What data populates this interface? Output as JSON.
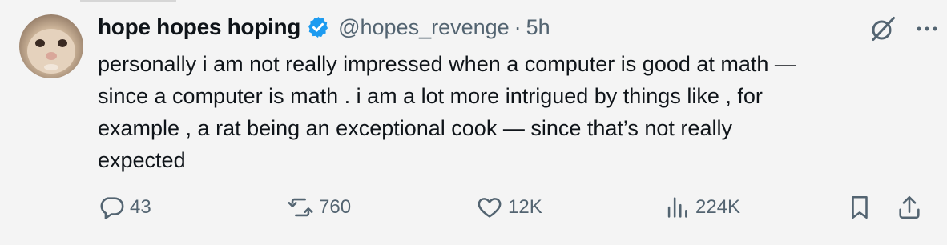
{
  "author": {
    "display_name": "hope hopes hoping",
    "handle": "@hopes_revenge",
    "separator": "·",
    "time": "5h"
  },
  "tweet": {
    "text": "personally  i am  not really impressed  when a  computer is good at math —\nsince  a computer is  math . i am a lot more  intrigued by things like ,  for\nexample ,  a  rat being an exceptional  cook — since that’s  not really\nexpected"
  },
  "metrics": {
    "replies": "43",
    "retweets": "760",
    "likes": "12K",
    "views": "224K"
  },
  "icons": [
    "verified-badge-icon",
    "grok-icon",
    "more-icon",
    "reply-icon",
    "retweet-icon",
    "like-icon",
    "views-icon",
    "bookmark-icon",
    "share-icon"
  ],
  "colors": {
    "verified": "#1d9bf0",
    "muted": "#536471",
    "text": "#0f1419",
    "background": "#f4f4f4"
  }
}
